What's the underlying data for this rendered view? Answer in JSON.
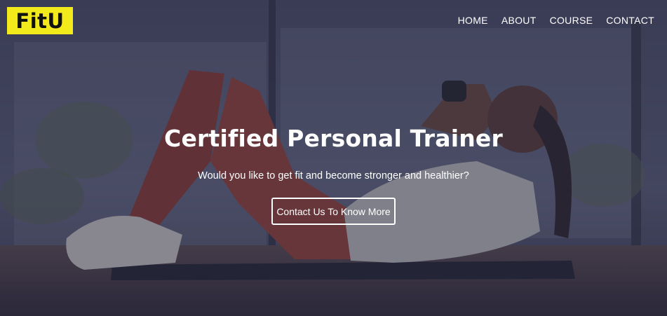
{
  "brand": {
    "logo_text": "FitU",
    "accent_color": "#f2ea1b"
  },
  "nav": {
    "items": [
      {
        "label": "HOME"
      },
      {
        "label": "ABOUT"
      },
      {
        "label": "COURSE"
      },
      {
        "label": "CONTACT"
      }
    ]
  },
  "hero": {
    "headline": "Certified Personal Trainer",
    "subtext": "Would you like to get fit and become stronger and healthier?",
    "cta_label": "Contact Us To Know More"
  }
}
